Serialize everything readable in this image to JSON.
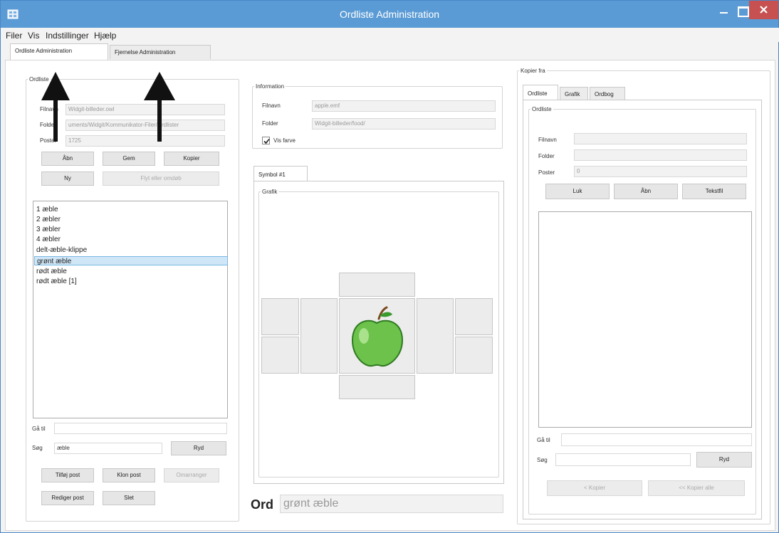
{
  "window": {
    "title": "Ordliste Administration"
  },
  "menu": [
    "Filer",
    "Vis",
    "Indstillinger",
    "Hjælp"
  ],
  "tabs": [
    "Ordliste Administration",
    "Fjernelse Administration"
  ],
  "left": {
    "group_title": "Ordliste",
    "filename_label": "Filnavn",
    "filename_value": "Widgit-billeder.owl",
    "folder_label": "Folder",
    "folder_value": "uments/Widgit/Kommunikator-Filer/Ordlister",
    "entries_label": "Poster",
    "entries_value": "1725",
    "btn_open": "Åbn",
    "btn_save": "Gem",
    "btn_copy": "Kopier",
    "btn_new": "Ny",
    "btn_move": "Flyt eller omdøb",
    "list": [
      "1 æble",
      "2 æbler",
      "3 æbler",
      "4 æbler",
      "delt-æble-klippe",
      "grønt æble",
      "rødt æble",
      "rødt æble [1]"
    ],
    "goto_label": "Gå til",
    "search_label": "Søg",
    "search_value": "æble",
    "btn_clear": "Ryd",
    "btn_add": "Tilføj post",
    "btn_clone": "Klon post",
    "btn_reorder": "Omarranger",
    "btn_edit": "Rediger post",
    "btn_delete": "Slet"
  },
  "middle": {
    "info_title": "Information",
    "filename_label": "Filnavn",
    "filename_value": "apple.emf",
    "folder_label": "Folder",
    "folder_value": "Widgit-billeder/food/",
    "show_color_label": "Vis farve",
    "show_color_checked": true,
    "symbol_tab": "Symbol #1",
    "graphic_title": "Grafik",
    "word_label": "Ord",
    "word_value": "grønt æble"
  },
  "right": {
    "group_title": "Kopier fra",
    "tabs": [
      "Ordliste",
      "Grafik",
      "Ordbog"
    ],
    "inner_title": "Ordliste",
    "filename_label": "Filnavn",
    "folder_label": "Folder",
    "entries_label": "Poster",
    "entries_value": "0",
    "btn_close": "Luk",
    "btn_open": "Åbn",
    "btn_textfile": "Tekstfil",
    "goto_label": "Gå til",
    "search_label": "Søg",
    "btn_clear": "Ryd",
    "btn_copy": "< Kopier",
    "btn_copy_all": "<< Kopier alle"
  },
  "colors": {
    "titlebar": "#5b9bd5",
    "close_button": "#c75050",
    "selection": "#cfe6f7",
    "apple_green": "#6cc24a"
  }
}
